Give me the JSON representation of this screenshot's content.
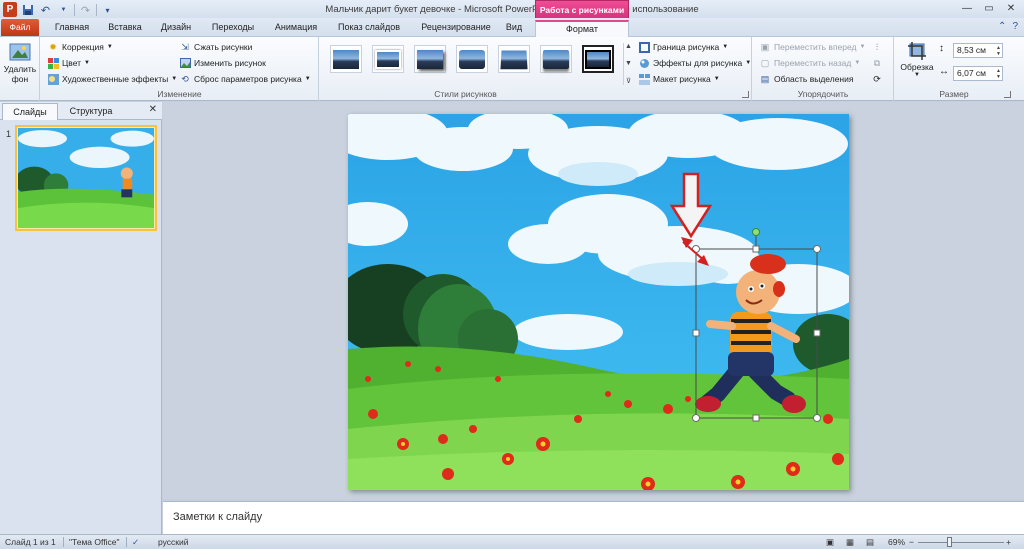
{
  "titlebar": {
    "title": "Мальчик дарит букет девочке  -  Microsoft PowerPoint некоммерческое использование",
    "context_group": "Работа с рисунками",
    "app_icon": "P",
    "qat": [
      "save-icon",
      "undo-icon",
      "redo-icon",
      "customize-icon"
    ]
  },
  "tabs": {
    "file": "Файл",
    "items": [
      "Главная",
      "Вставка",
      "Дизайн",
      "Переходы",
      "Анимация",
      "Показ слайдов",
      "Рецензирование",
      "Вид",
      "Формат"
    ],
    "active": "Формат"
  },
  "ribbon": {
    "remove_bg": {
      "line1": "Удалить",
      "line2": "фон"
    },
    "adjust": {
      "label": "Изменение",
      "correction": "Коррекция",
      "color": "Цвет",
      "artistic": "Художественные эффекты",
      "compress": "Сжать рисунки",
      "change": "Изменить рисунок",
      "reset": "Сброс параметров рисунка"
    },
    "styles": {
      "label": "Стили рисунков",
      "thumb_count": 7,
      "selected_index": 6
    },
    "picture_cmds": {
      "border": "Граница рисунка",
      "effects": "Эффекты для рисунка",
      "layout": "Макет рисунка"
    },
    "arrange": {
      "label": "Упорядочить",
      "bring_forward": "Переместить вперед",
      "send_backward": "Переместить назад",
      "selection_pane": "Область выделения"
    },
    "size": {
      "label": "Размер",
      "crop": "Обрезка",
      "height": "8,53 см",
      "width": "6,07 см"
    }
  },
  "left_pane": {
    "tab_slides": "Слайды",
    "tab_outline": "Структура",
    "slide_number": "1"
  },
  "notes": {
    "placeholder": "Заметки к слайду"
  },
  "status": {
    "slide_info": "Слайд 1 из 1",
    "theme": "\"Тема Office\"",
    "language": "русский",
    "zoom": "69%",
    "zoom_fraction": 0.35
  },
  "colors": {
    "accent_context": "#e34a8c",
    "selection_red": "#d42020",
    "sky": "#36aee9",
    "grass": "#5cc23a"
  }
}
